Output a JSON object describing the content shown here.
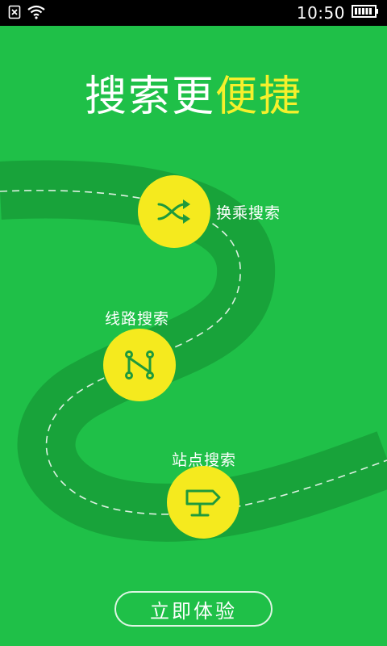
{
  "status_bar": {
    "time": "10:50",
    "icons": [
      "sim-blocked-icon",
      "wifi-icon",
      "battery-icon"
    ]
  },
  "headline": {
    "part1": "搜索更",
    "part2": "便捷"
  },
  "features": [
    {
      "label": "换乘搜索",
      "icon": "shuffle-icon"
    },
    {
      "label": "线路搜索",
      "icon": "route-icon"
    },
    {
      "label": "站点搜索",
      "icon": "signpost-icon"
    }
  ],
  "cta": {
    "label": "立即体验"
  },
  "colors": {
    "background": "#1fc048",
    "road": "#18a33a",
    "node": "#f5ea1e",
    "accent_text": "#f5f02c",
    "icon_stroke": "#1e9a3c"
  }
}
